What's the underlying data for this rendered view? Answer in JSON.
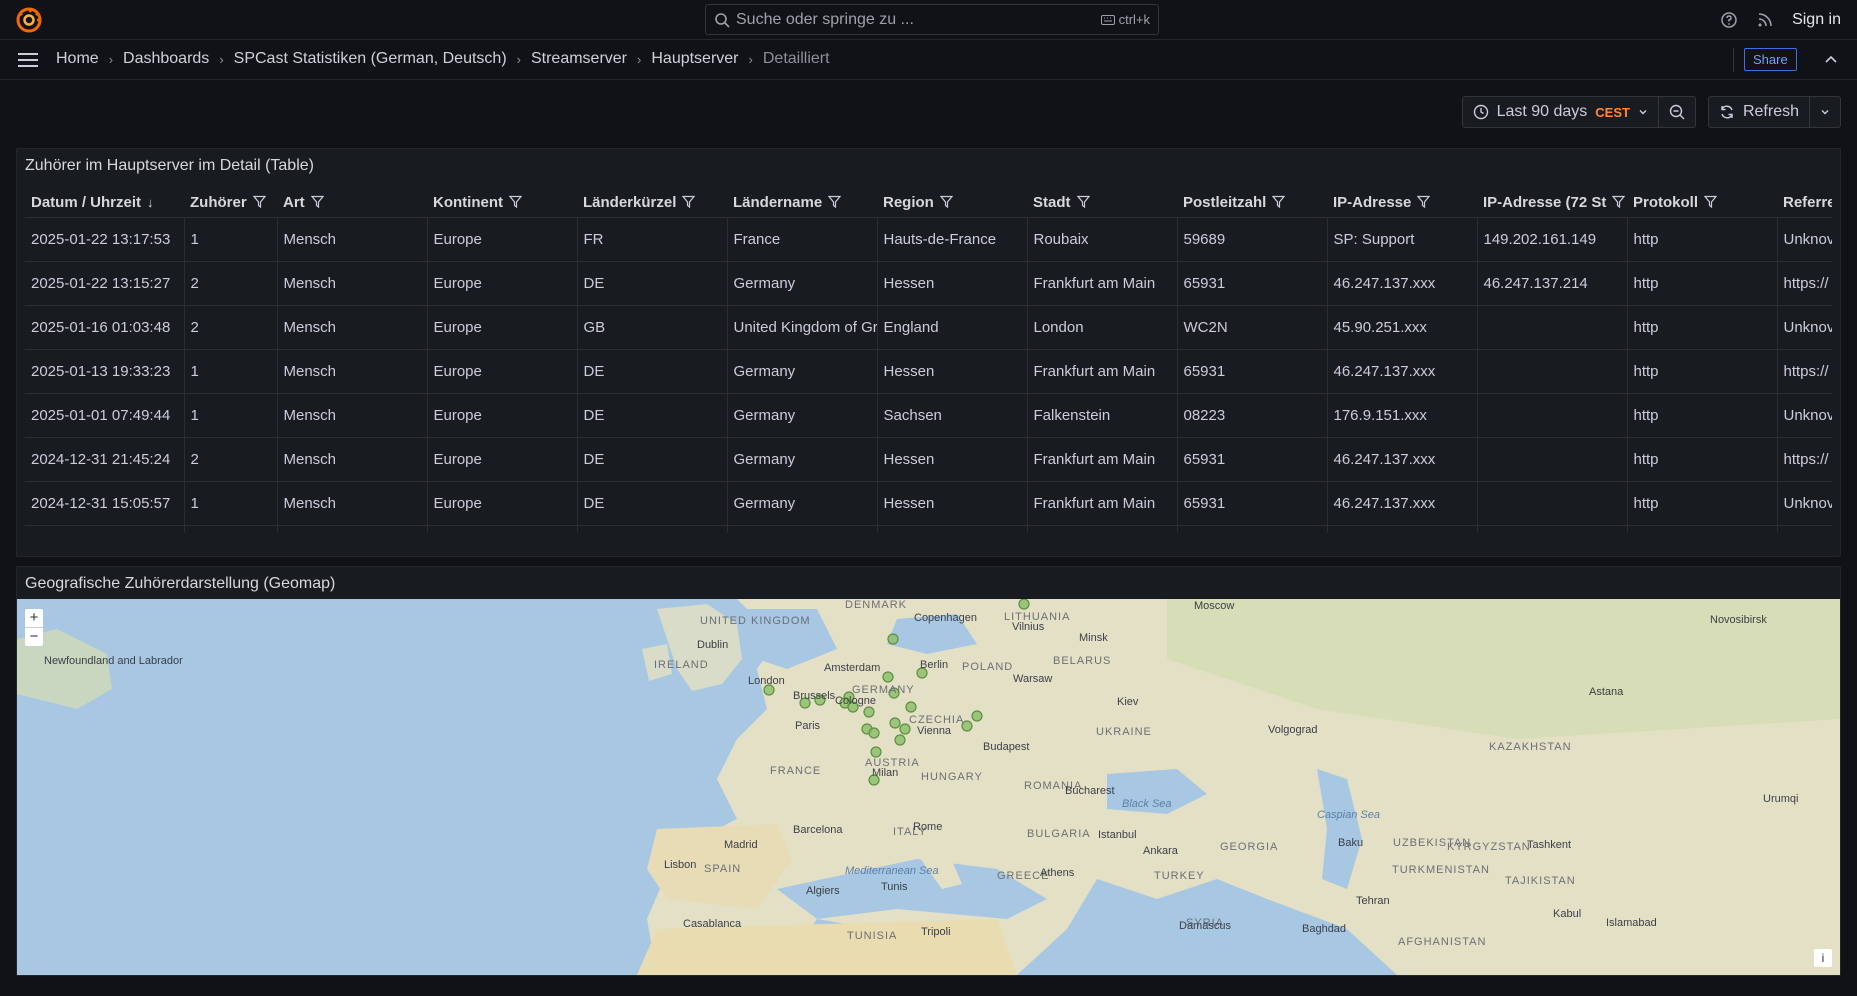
{
  "topbar": {
    "search_placeholder": "Suche oder springe zu ...",
    "search_shortcut": "ctrl+k",
    "sign_in": "Sign in"
  },
  "breadcrumb": [
    "Home",
    "Dashboards",
    "SPCast Statistiken (German, Deutsch)",
    "Streamserver",
    "Hauptserver",
    "Detailliert"
  ],
  "share_label": "Share",
  "timepicker": {
    "range": "Last 90 days",
    "tz": "CEST"
  },
  "refresh_label": "Refresh",
  "table_panel": {
    "title": "Zuhörer im Hauptserver im Detail (Table)",
    "columns": [
      "Datum / Uhrzeit",
      "Zuhörer",
      "Art",
      "Kontinent",
      "Länderkürzel",
      "Ländername",
      "Region",
      "Stadt",
      "Postleitzahl",
      "IP-Adresse",
      "IP-Adresse (72 St",
      "Protokoll",
      "Referre"
    ],
    "rows": [
      [
        "2025-01-22 13:17:53",
        "1",
        "Mensch",
        "Europe",
        "FR",
        "France",
        "Hauts-de-France",
        "Roubaix",
        "59689",
        "SP: Support",
        "149.202.161.149",
        "http",
        "Unknov"
      ],
      [
        "2025-01-22 13:15:27",
        "2",
        "Mensch",
        "Europe",
        "DE",
        "Germany",
        "Hessen",
        "Frankfurt am Main",
        "65931",
        "46.247.137.xxx",
        "46.247.137.214",
        "http",
        "https://"
      ],
      [
        "2025-01-16 01:03:48",
        "2",
        "Mensch",
        "Europe",
        "GB",
        "United Kingdom of Gr",
        "England",
        "London",
        "WC2N",
        "45.90.251.xxx",
        "",
        "http",
        "Unknov"
      ],
      [
        "2025-01-13 19:33:23",
        "1",
        "Mensch",
        "Europe",
        "DE",
        "Germany",
        "Hessen",
        "Frankfurt am Main",
        "65931",
        "46.247.137.xxx",
        "",
        "http",
        "https://"
      ],
      [
        "2025-01-01 07:49:44",
        "1",
        "Mensch",
        "Europe",
        "DE",
        "Germany",
        "Sachsen",
        "Falkenstein",
        "08223",
        "176.9.151.xxx",
        "",
        "http",
        "Unknov"
      ],
      [
        "2024-12-31 21:45:24",
        "2",
        "Mensch",
        "Europe",
        "DE",
        "Germany",
        "Hessen",
        "Frankfurt am Main",
        "65931",
        "46.247.137.xxx",
        "",
        "http",
        "https://"
      ],
      [
        "2024-12-31 15:05:57",
        "1",
        "Mensch",
        "Europe",
        "DE",
        "Germany",
        "Hessen",
        "Frankfurt am Main",
        "65931",
        "46.247.137.xxx",
        "",
        "http",
        "Unknov"
      ]
    ]
  },
  "map_panel": {
    "title": "Geografische Zuhörerdarstellung (Geomap)",
    "zoom_in": "+",
    "zoom_out": "−",
    "info": "i",
    "labels": {
      "countries": [
        "UNITED KINGDOM",
        "IRELAND",
        "DENMARK",
        "LITHUANIA",
        "BELARUS",
        "POLAND",
        "GERMANY",
        "CZECHIA",
        "UKRAINE",
        "FRANCE",
        "AUSTRIA",
        "HUNGARY",
        "ROMANIA",
        "BULGARIA",
        "ITALY",
        "SPAIN",
        "GREECE",
        "TURKEY",
        "GEORGIA",
        "KAZAKHSTAN",
        "UZBEKISTAN",
        "KYRGYZSTAN",
        "TURKMENISTAN",
        "TAJIKISTAN",
        "SYRIA",
        "AFGHANISTAN",
        "TUNISIA"
      ],
      "cities": [
        "Newfoundland and Labrador",
        "Dublin",
        "London",
        "Amsterdam",
        "Brussels",
        "Cologne",
        "Paris",
        "Copenhagen",
        "Vilnius",
        "Minsk",
        "Moscow",
        "Berlin",
        "Warsaw",
        "Kiev",
        "Vienna",
        "Budapest",
        "Milan",
        "Bucharest",
        "Rome",
        "Madrid",
        "Barcelona",
        "Lisbon",
        "Algiers",
        "Tunis",
        "Casablanca",
        "Tripoli",
        "Istanbul",
        "Ankara",
        "Athens",
        "Volgograd",
        "Astana",
        "Novosibirsk",
        "Baku",
        "Tashkent",
        "Urumqi",
        "Tehran",
        "Kabul",
        "Islamabad",
        "Damascus",
        "Baghdad"
      ],
      "seas": [
        "Black Sea",
        "Caspian Sea",
        "Mediterranean Sea"
      ]
    }
  }
}
